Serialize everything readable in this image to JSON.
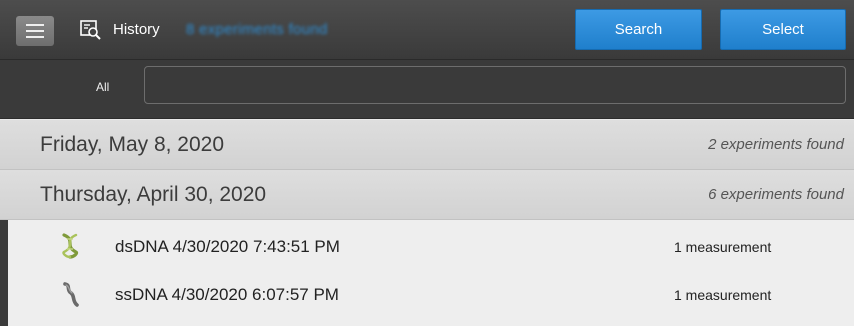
{
  "header": {
    "menu_icon": "hamburger-menu-icon",
    "history_icon": "history-search-icon",
    "title": "History",
    "found_text": "8 experiments found",
    "search_label": "Search",
    "select_label": "Select",
    "accent_color": "#1f7fcc"
  },
  "filter": {
    "label": "All",
    "value": "",
    "placeholder": ""
  },
  "groups": [
    {
      "date": "Friday, May 8, 2020",
      "count": "2 experiments found"
    },
    {
      "date": "Thursday, April 30, 2020",
      "count": "6 experiments found"
    }
  ],
  "experiments": [
    {
      "name": "dsDNA 4/30/2020 7:43:51 PM",
      "measurements": "1 measurement",
      "icon": "dsdna-helix-icon"
    },
    {
      "name": "ssDNA 4/30/2020 6:07:57 PM",
      "measurements": "1 measurement",
      "icon": "ssdna-strand-icon"
    }
  ]
}
